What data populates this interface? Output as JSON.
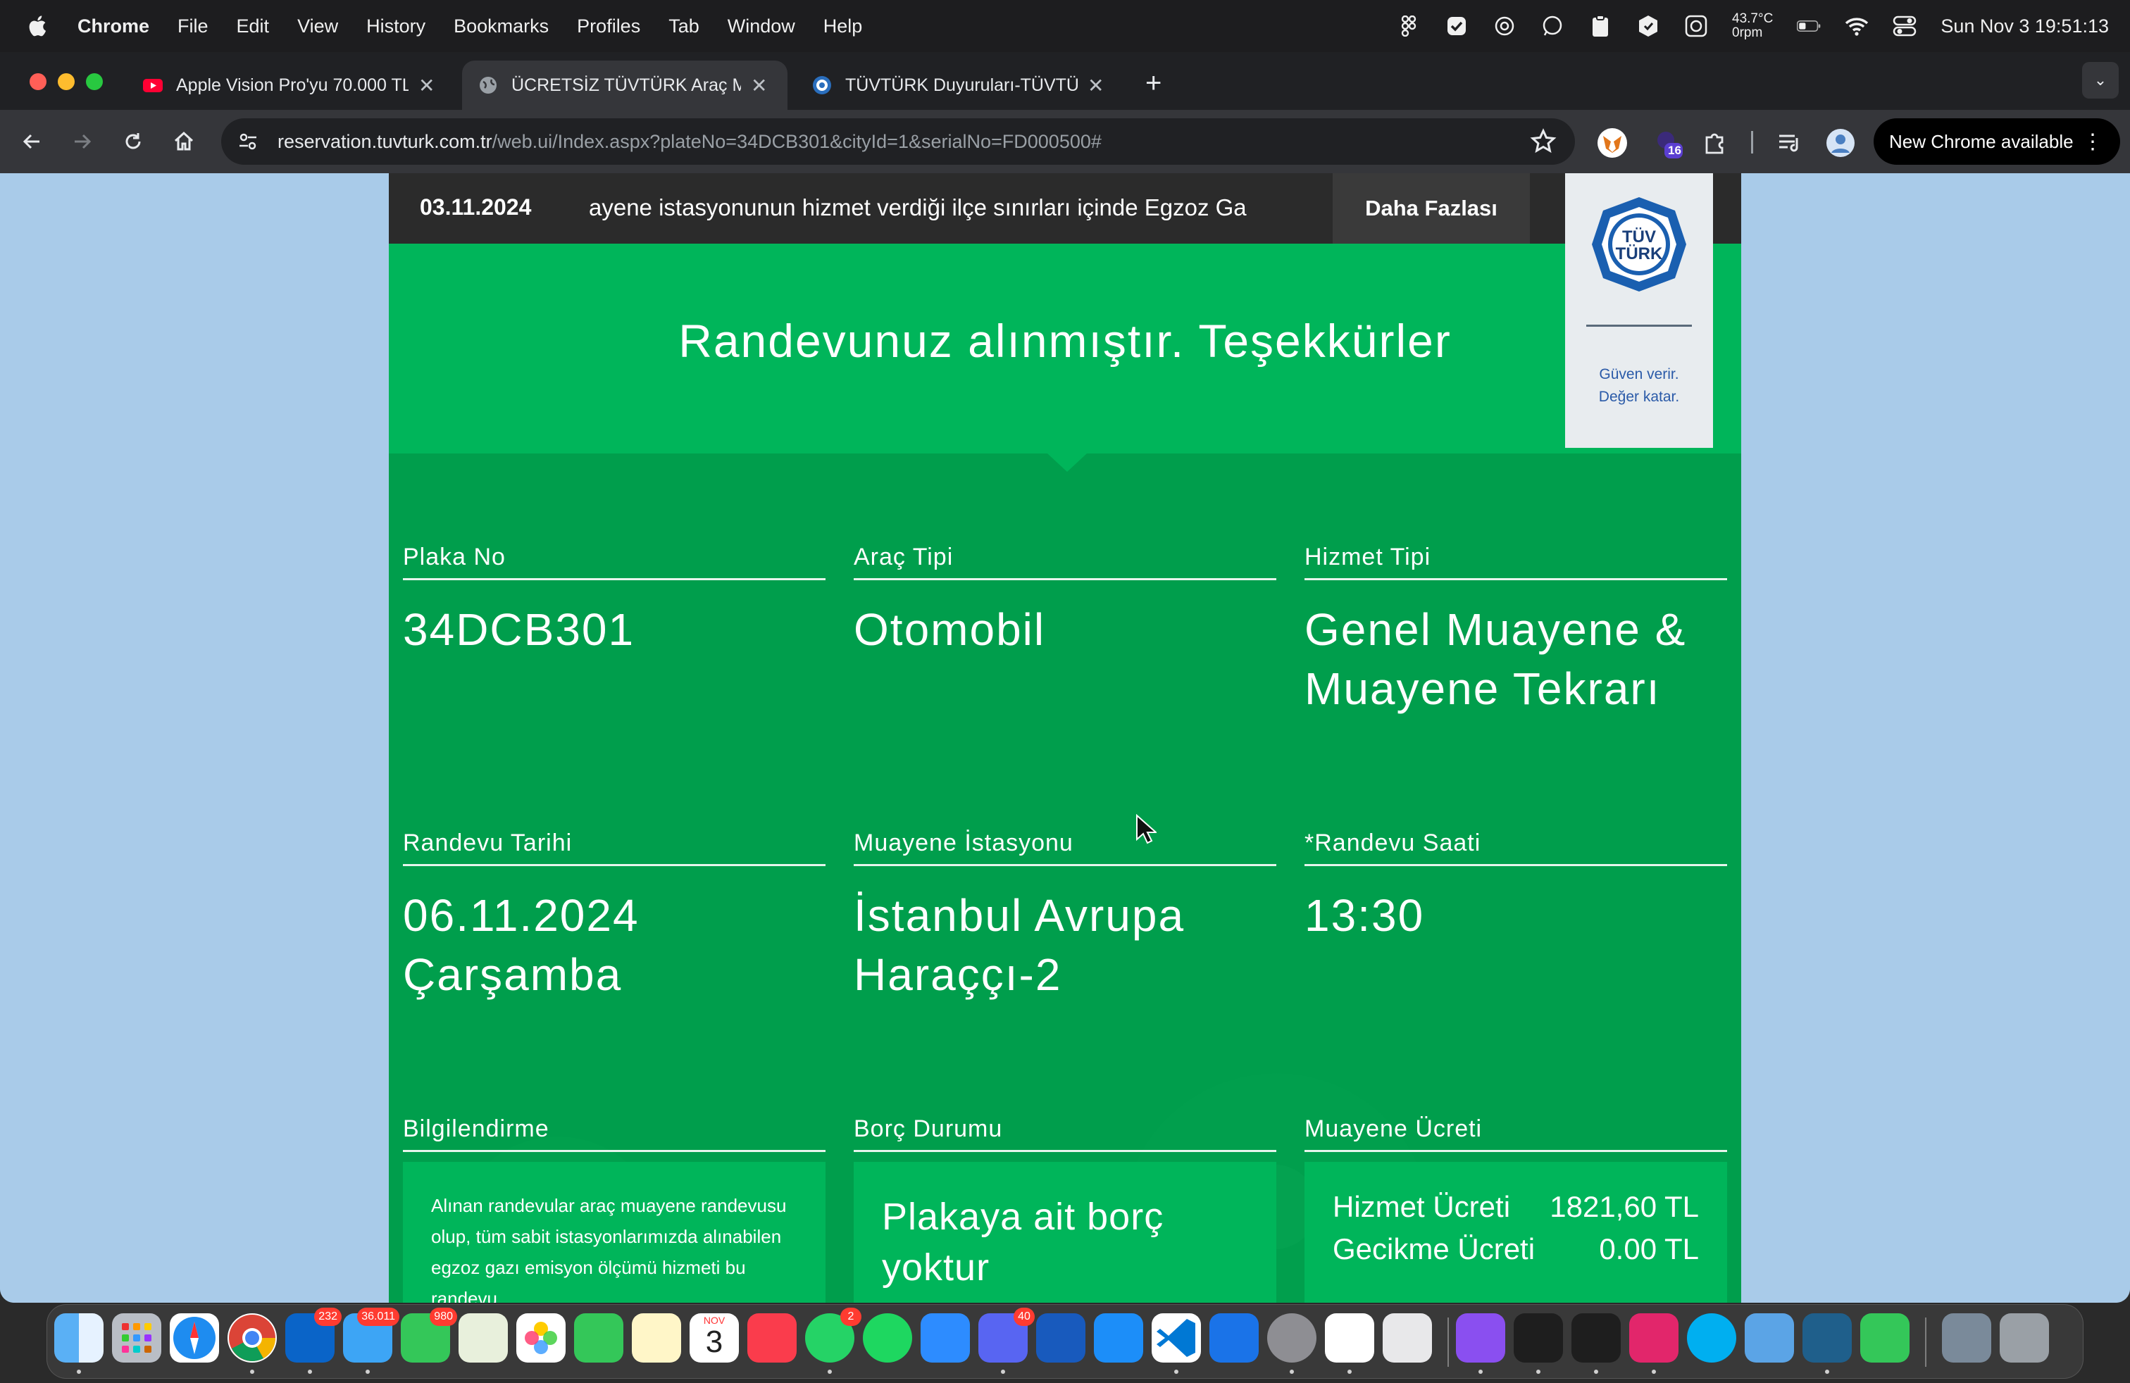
{
  "menubar": {
    "app_name": "Chrome",
    "items": [
      "File",
      "Edit",
      "View",
      "History",
      "Bookmarks",
      "Profiles",
      "Tab",
      "Window",
      "Help"
    ],
    "temperature": "43.7°C",
    "fan": "0rpm",
    "clock": "Sun Nov 3  19:51:13"
  },
  "tabs": [
    {
      "title": "Apple Vision Pro'yu 70.000 TL",
      "icon": "youtube-icon"
    },
    {
      "title": "ÜCRETSİZ TÜVTÜRK Araç Mu",
      "icon": "globe-icon",
      "active": true
    },
    {
      "title": "TÜVTÜRK Duyuruları-TÜVTÜRK",
      "icon": "tuvturk-favicon-icon"
    }
  ],
  "toolbar": {
    "url_host": "reservation.tuvturk.com.tr",
    "url_path": "/web.ui/Index.aspx?plateNo=34DCB301&cityId=1&serialNo=FD000500#",
    "extension_badge": "16",
    "update_label": "New Chrome available"
  },
  "newsbar": {
    "date": "03.11.2024",
    "ticker": "ayene istasyonunun hizmet verdiği ilçe sınırları içinde Egzoz Ga",
    "more_label": "Daha Fazlası"
  },
  "logo": {
    "top": "TÜV",
    "bottom": "TÜRK",
    "slogan_line1": "Güven verir.",
    "slogan_line2": "Değer katar."
  },
  "hero": {
    "title": "Randevunuz alınmıştır. Teşekkürler"
  },
  "fields": {
    "plate": {
      "label": "Plaka No",
      "value": "34DCB301"
    },
    "vehicle_type": {
      "label": "Araç Tipi",
      "value": "Otomobil"
    },
    "service_type": {
      "label": "Hizmet Tipi",
      "value_line1": "Genel Muayene &",
      "value_line2": "Muayene Tekrarı"
    },
    "date": {
      "label": "Randevu Tarihi",
      "value_line1": "06.11.2024",
      "value_line2": "Çarşamba"
    },
    "station": {
      "label": "Muayene İstasyonu",
      "value_line1": "İstanbul Avrupa",
      "value_line2": "Haraççı-2"
    },
    "time": {
      "label": "*Randevu Saati",
      "value": "13:30"
    },
    "info": {
      "label": "Bilgilendirme",
      "text": "Alınan randevular araç muayene randevusu olup, tüm sabit istasyonlarımızda alınabilen egzoz gazı emisyon ölçümü hizmeti bu randevu"
    },
    "debt": {
      "label": "Borç Durumu",
      "text_line1": "Plakaya ait borç",
      "text_line2": "yoktur"
    },
    "fee": {
      "label": "Muayene Ücreti",
      "rows": [
        {
          "name": "Hizmet Ücreti",
          "amount": "1821,60 TL"
        },
        {
          "name": "Gecikme Ücreti",
          "amount": "0.00 TL"
        }
      ]
    }
  },
  "dock": {
    "apps": [
      "finder",
      "launchpad",
      "safari",
      "chrome",
      "outlook",
      "mail",
      "messages",
      "maps",
      "photos",
      "facetime",
      "notes",
      "calendar",
      "music",
      "whatsapp",
      "spotify",
      "zoom",
      "discord",
      "word",
      "app-store",
      "vscode",
      "xcode",
      "system-settings",
      "chatgpt",
      "iphone-mirroring",
      "github-desktop",
      "terminal",
      "figma",
      "phpstorm",
      "skype",
      "network-radar",
      "mysql-workbench",
      "messages-2",
      "disk-utility",
      "trash"
    ],
    "badges": {
      "outlook": "232",
      "mail": "36.011",
      "messages": "980",
      "whatsapp": "2",
      "discord": "40"
    },
    "calendar_month": "NOV",
    "calendar_day": "3"
  }
}
